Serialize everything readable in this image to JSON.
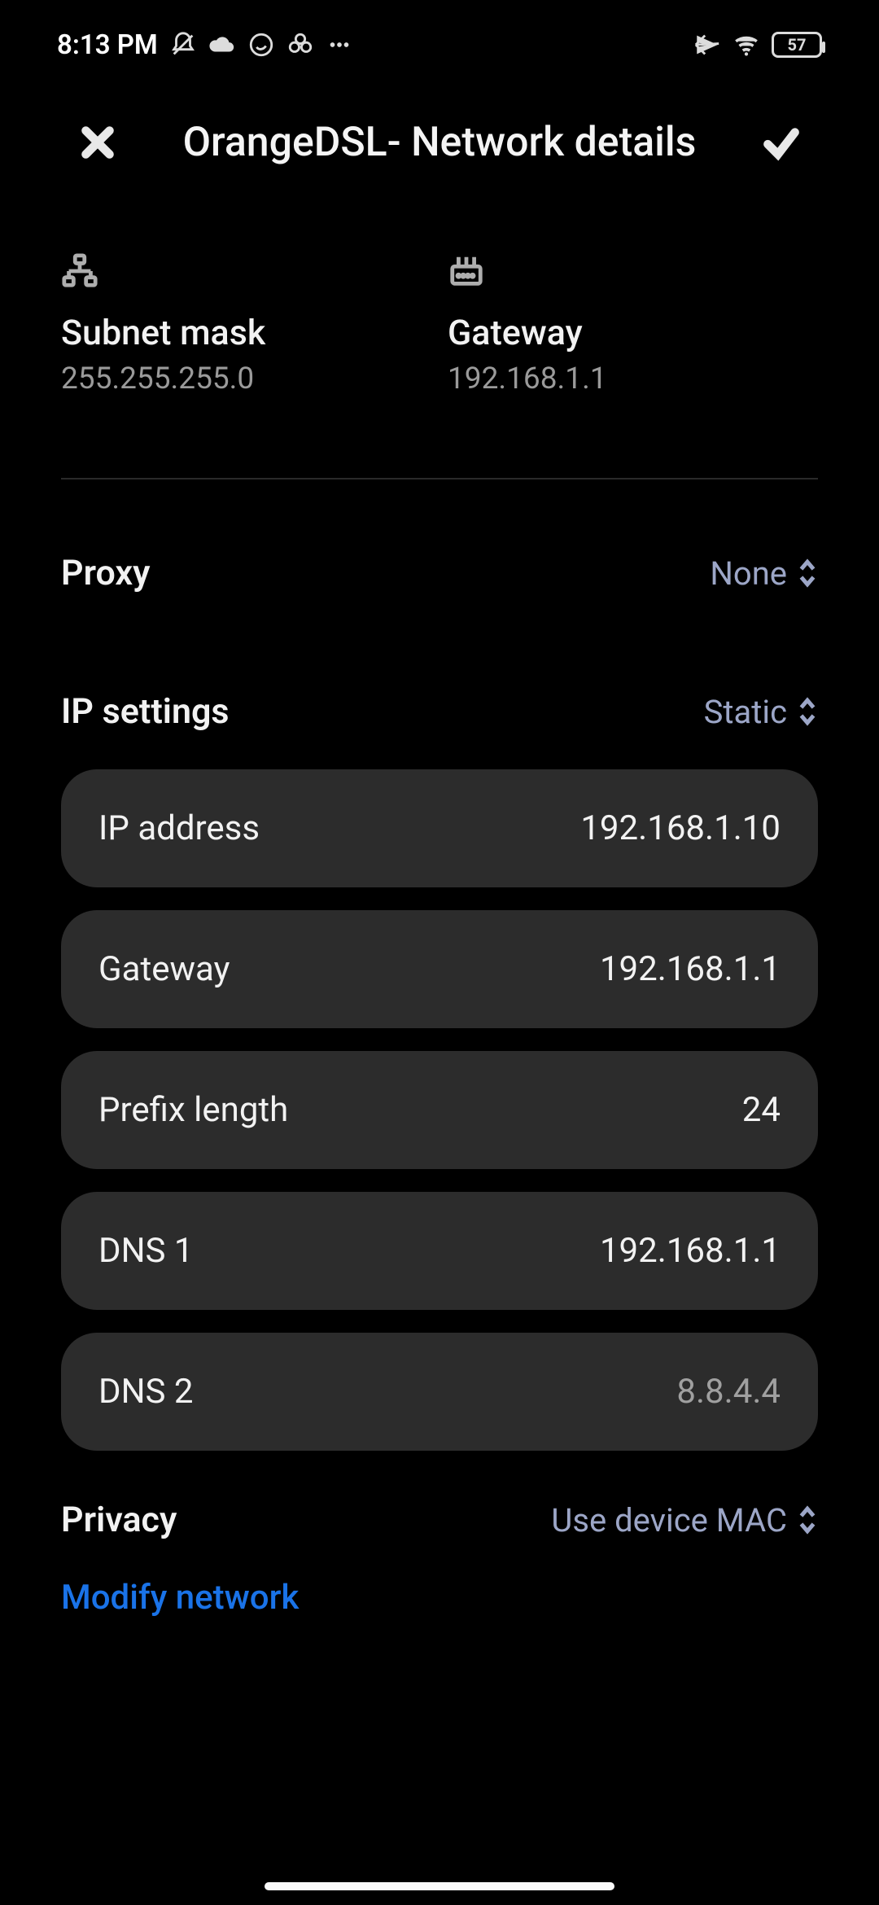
{
  "status": {
    "time": "8:13 PM",
    "battery": "57"
  },
  "header": {
    "title": "OrangeDSL- Network details"
  },
  "info": {
    "subnet": {
      "label": "Subnet mask",
      "value": "255.255.255.0"
    },
    "gateway": {
      "label": "Gateway",
      "value": "192.168.1.1"
    }
  },
  "settings": {
    "proxy": {
      "label": "Proxy",
      "value": "None"
    },
    "ip": {
      "label": "IP settings",
      "value": "Static"
    },
    "privacy": {
      "label": "Privacy",
      "value": "Use device MAC"
    }
  },
  "fields": {
    "ip_address": {
      "label": "IP address",
      "value": "192.168.1.10"
    },
    "gateway": {
      "label": "Gateway",
      "value": "192.168.1.1"
    },
    "prefix": {
      "label": "Prefix length",
      "value": "24"
    },
    "dns1": {
      "label": "DNS 1",
      "value": "192.168.1.1"
    },
    "dns2": {
      "label": "DNS 2",
      "hint": "8.8.4.4"
    }
  },
  "modify": "Modify network"
}
